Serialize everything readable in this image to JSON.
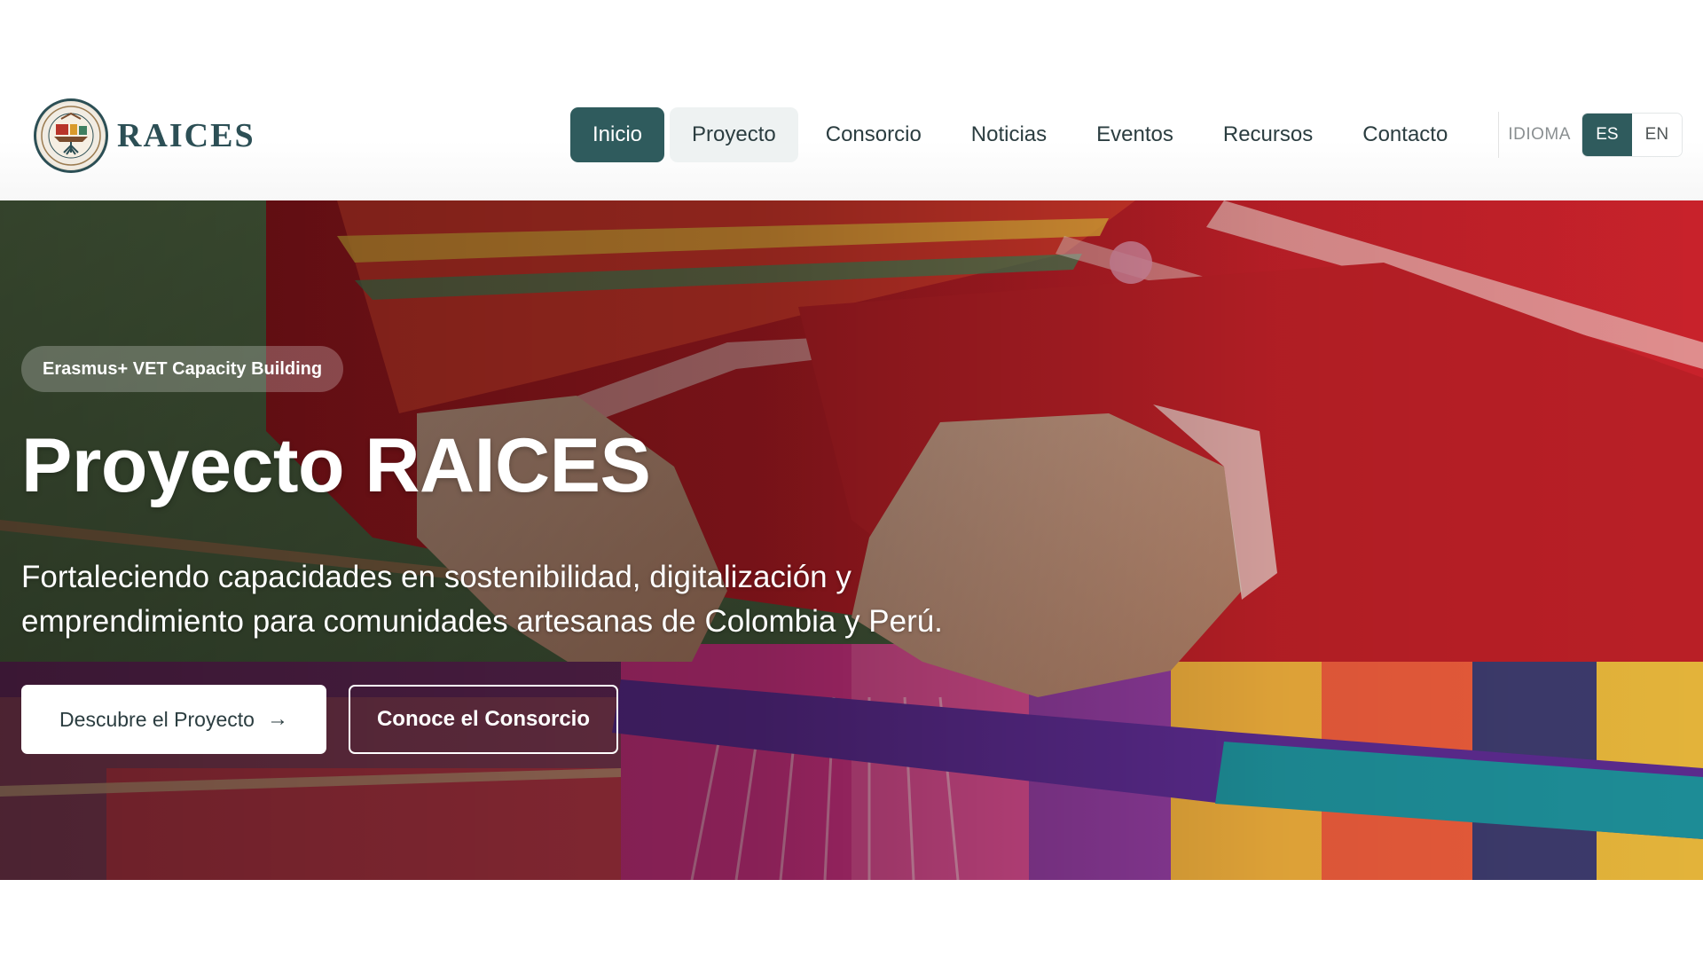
{
  "brand": {
    "name": "RAICES",
    "logo_icon": "raices-emblem-icon"
  },
  "nav": {
    "items": [
      {
        "label": "Inicio",
        "state": "active"
      },
      {
        "label": "Proyecto",
        "state": "hover"
      },
      {
        "label": "Consorcio",
        "state": "default"
      },
      {
        "label": "Noticias",
        "state": "default"
      },
      {
        "label": "Eventos",
        "state": "default"
      },
      {
        "label": "Recursos",
        "state": "default"
      },
      {
        "label": "Contacto",
        "state": "default"
      }
    ],
    "language_label": "IDIOMA",
    "languages": [
      {
        "label": "ES",
        "selected": true
      },
      {
        "label": "EN",
        "selected": false
      }
    ]
  },
  "hero": {
    "badge": "Erasmus+ VET Capacity Building",
    "title": "Proyecto RAICES",
    "subtitle": "Fortaleciendo capacidades en sostenibilidad, digitalización y emprendimiento para comunidades artesanas de Colombia y Perú.",
    "primary_button": {
      "label": "Descubre el Proyecto",
      "icon": "arrow-right-icon"
    },
    "secondary_button": {
      "label": "Conoce el Consorcio"
    }
  },
  "colors": {
    "accent": "#2f5b5d",
    "text_dark": "#2b3d40",
    "hover_bg": "#eef2f2"
  }
}
